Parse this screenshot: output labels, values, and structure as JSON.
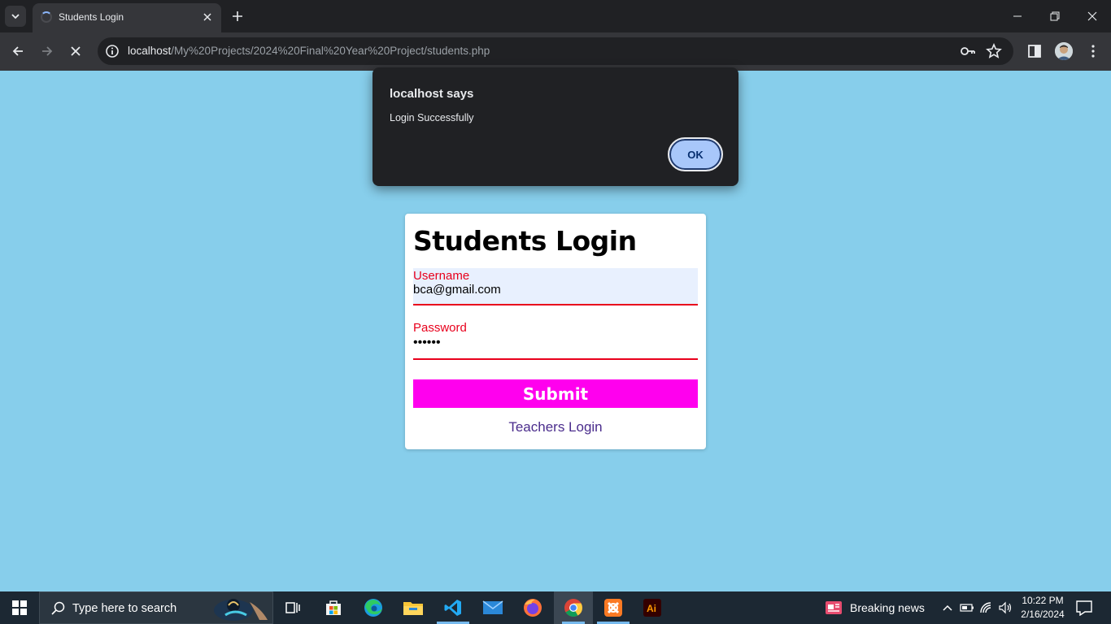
{
  "browser": {
    "tab": {
      "title": "Students Login"
    },
    "url": {
      "host": "localhost",
      "path": "/My%20Projects/2024%20Final%20Year%20Project/students.php"
    }
  },
  "dialog": {
    "title": "localhost says",
    "message": "Login Successfully",
    "ok_label": "OK"
  },
  "page": {
    "background": "#87CEEB",
    "heading": "Students Login",
    "username": {
      "label": "Username",
      "value": "bca@gmail.com"
    },
    "password": {
      "label": "Password",
      "value": "••••••"
    },
    "submit_label": "Submit",
    "teachers_link": "Teachers Login",
    "accent_color": "#ff00ee",
    "label_color": "#e8001c"
  },
  "taskbar": {
    "search_placeholder": "Type here to search",
    "apps": [
      "task-view-icon",
      "microsoft-store-icon",
      "edge-icon",
      "file-explorer-icon",
      "vscode-icon",
      "mail-icon",
      "firefox-icon",
      "chrome-icon",
      "xampp-icon",
      "illustrator-icon"
    ],
    "news": "Breaking news",
    "time": "10:22 PM",
    "date": "2/16/2024"
  }
}
